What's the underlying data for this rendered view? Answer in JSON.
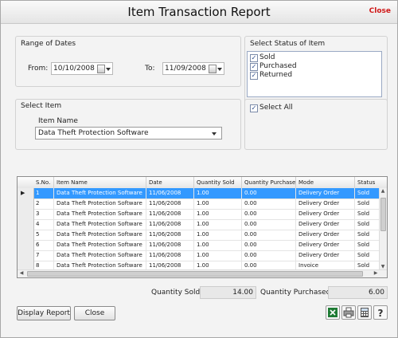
{
  "window": {
    "title": "Item Transaction Report",
    "close_label": "Close"
  },
  "dates": {
    "group_label": "Range of Dates",
    "from_label": "From:",
    "from_value": "10/10/2008",
    "to_label": "To:",
    "to_value": "11/09/2008"
  },
  "status": {
    "group_label": "Select Status of Item",
    "options": [
      {
        "label": "Sold",
        "checked": "✓"
      },
      {
        "label": "Purchased",
        "checked": "✓"
      },
      {
        "label": "Returned",
        "checked": "✓"
      }
    ],
    "select_all_label": "Select All",
    "select_all_checked": "✓"
  },
  "item": {
    "group_label": "Select Item",
    "field_label": "Item Name",
    "value": "Data Theft Protection Software"
  },
  "grid": {
    "columns": [
      "S.No.",
      "Item Name",
      "Date",
      "Quantity Sold",
      "Quantity Purchased",
      "Mode",
      "Status"
    ],
    "rows": [
      [
        "1",
        "Data Theft Protection Software",
        "11/06/2008",
        "1.00",
        "0.00",
        "Delivery Order",
        "Sold"
      ],
      [
        "2",
        "Data Theft Protection Software",
        "11/06/2008",
        "1.00",
        "0.00",
        "Delivery Order",
        "Sold"
      ],
      [
        "3",
        "Data Theft Protection Software",
        "11/06/2008",
        "1.00",
        "0.00",
        "Delivery Order",
        "Sold"
      ],
      [
        "4",
        "Data Theft Protection Software",
        "11/06/2008",
        "1.00",
        "0.00",
        "Delivery Order",
        "Sold"
      ],
      [
        "5",
        "Data Theft Protection Software",
        "11/06/2008",
        "1.00",
        "0.00",
        "Delivery Order",
        "Sold"
      ],
      [
        "6",
        "Data Theft Protection Software",
        "11/06/2008",
        "1.00",
        "0.00",
        "Delivery Order",
        "Sold"
      ],
      [
        "7",
        "Data Theft Protection Software",
        "11/06/2008",
        "1.00",
        "0.00",
        "Delivery Order",
        "Sold"
      ],
      [
        "8",
        "Data Theft Protection Software",
        "11/06/2008",
        "1.00",
        "0.00",
        "Invoice",
        "Sold"
      ]
    ],
    "row_pointer": "▶"
  },
  "totals": {
    "sold_label": "Quantity Sold",
    "sold_value": "14.00",
    "purchased_label": "Quantity Purchased",
    "purchased_value": "6.00"
  },
  "buttons": {
    "display_report": "Display Report",
    "close": "Close"
  },
  "toolbar_icons": [
    "excel-icon",
    "print-icon",
    "calculator-icon",
    "help-icon"
  ],
  "colors": {
    "selection": "#3399ff",
    "close_link": "#d01818"
  }
}
